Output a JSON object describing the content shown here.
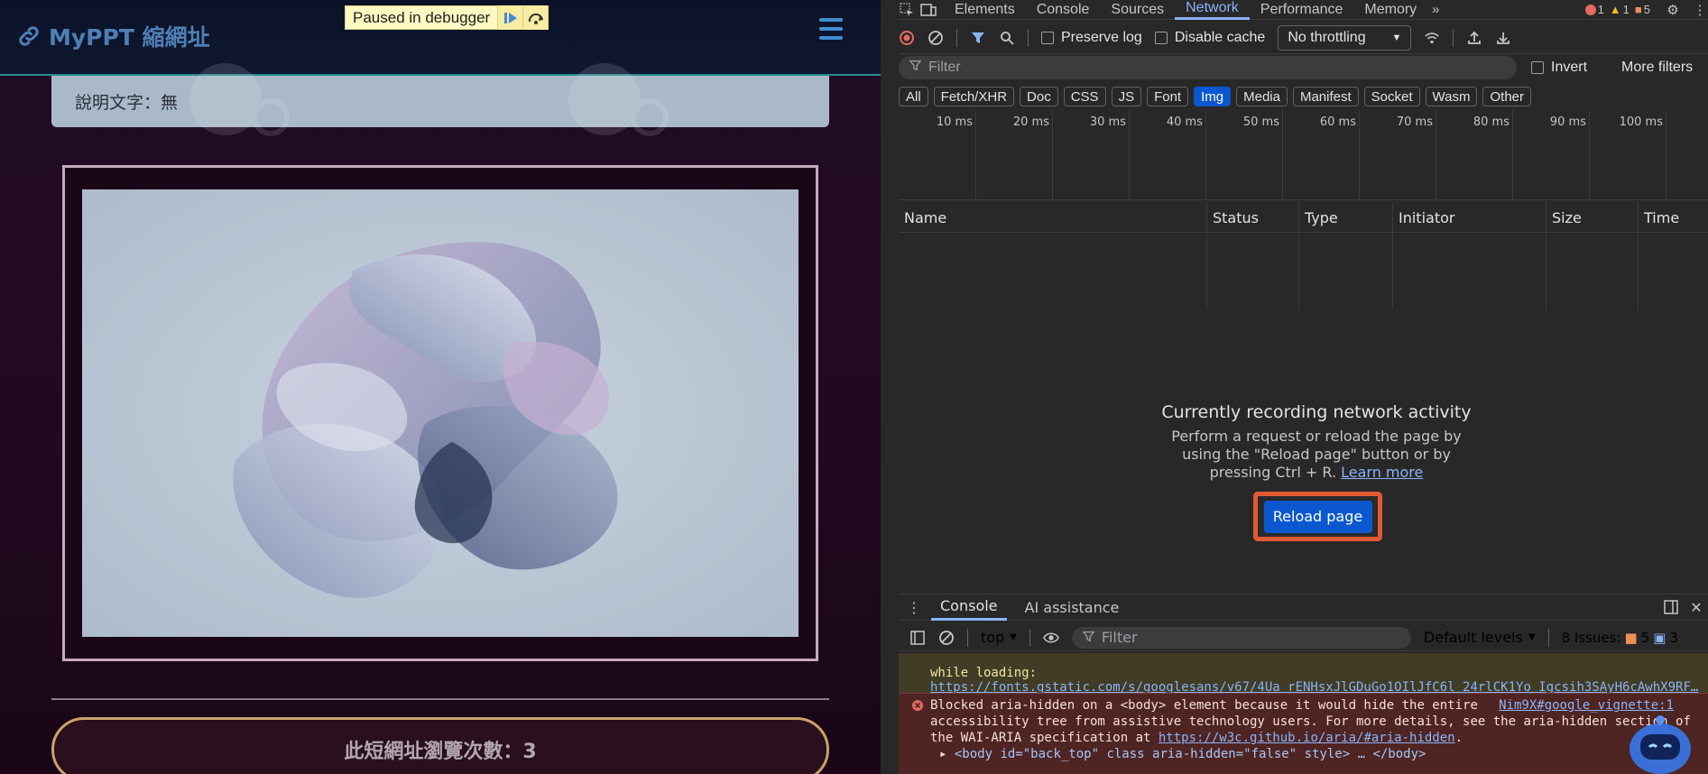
{
  "page": {
    "brand": "MyPPT 縮網址",
    "debugger_banner": "Paused in debugger",
    "description_text": "說明文字：無",
    "visit_count_text": "此短網址瀏覽次數：3"
  },
  "devtools": {
    "tabs": [
      "Elements",
      "Console",
      "Sources",
      "Network",
      "Performance",
      "Memory"
    ],
    "active_tab": "Network",
    "counts": {
      "errors": "1",
      "warnings": "1",
      "issues": "5"
    },
    "toolbar": {
      "preserve_log": "Preserve log",
      "disable_cache": "Disable cache",
      "throttling": "No throttling"
    },
    "filter": {
      "placeholder": "Filter",
      "invert": "Invert",
      "more_filters": "More filters"
    },
    "type_filters": [
      "All",
      "Fetch/XHR",
      "Doc",
      "CSS",
      "JS",
      "Font",
      "Img",
      "Media",
      "Manifest",
      "Socket",
      "Wasm",
      "Other"
    ],
    "active_type_filter": "Img",
    "timeline_ticks": [
      "10 ms",
      "20 ms",
      "30 ms",
      "40 ms",
      "50 ms",
      "60 ms",
      "70 ms",
      "80 ms",
      "90 ms",
      "100 ms"
    ],
    "table_columns": [
      "Name",
      "Status",
      "Type",
      "Initiator",
      "Size",
      "Time"
    ],
    "empty_state": {
      "title": "Currently recording network activity",
      "line1": "Perform a request or reload the page by",
      "line2": "using the \"Reload page\" button or by",
      "line3": "pressing Ctrl + R.",
      "learn_more": "Learn more",
      "reload_button": "Reload page"
    },
    "drawer": {
      "tabs": [
        "Console",
        "AI assistance"
      ],
      "context": "top",
      "filter_placeholder": "Filter",
      "levels": "Default levels",
      "issues_label": "8 Issues:",
      "issues_warn": "5",
      "issues_info": "3"
    },
    "console": {
      "warn_line1": "while loading:",
      "warn_url": "https://fonts.gstatic.com/s/googlesans/v67/4Ua_rENHsxJlGDuGo1OIlJfC6l_24rlCK1Yo_Igcsih3SAyH6cAwhX9RF…",
      "err_line1": "Blocked aria-hidden on a <body> element because it would hide the entire",
      "err_line2": "accessibility tree from assistive technology users. For more details, see the aria-hidden section of",
      "err_line3_pre": "the WAI-ARIA specification at ",
      "err_link": "https://w3c.github.io/aria/#aria-hidden",
      "err_source": "Nim9X#google_vignette:1",
      "body_node": "<body id=\"back_top\" class aria-hidden=\"false\" style> … </body>"
    }
  },
  "colors": {
    "accent": "#8ab4f8",
    "active_chip": "#0b57d0",
    "highlight_box": "#e05a33",
    "error_bg": "#4e2523",
    "warning_bg": "#413c26"
  }
}
